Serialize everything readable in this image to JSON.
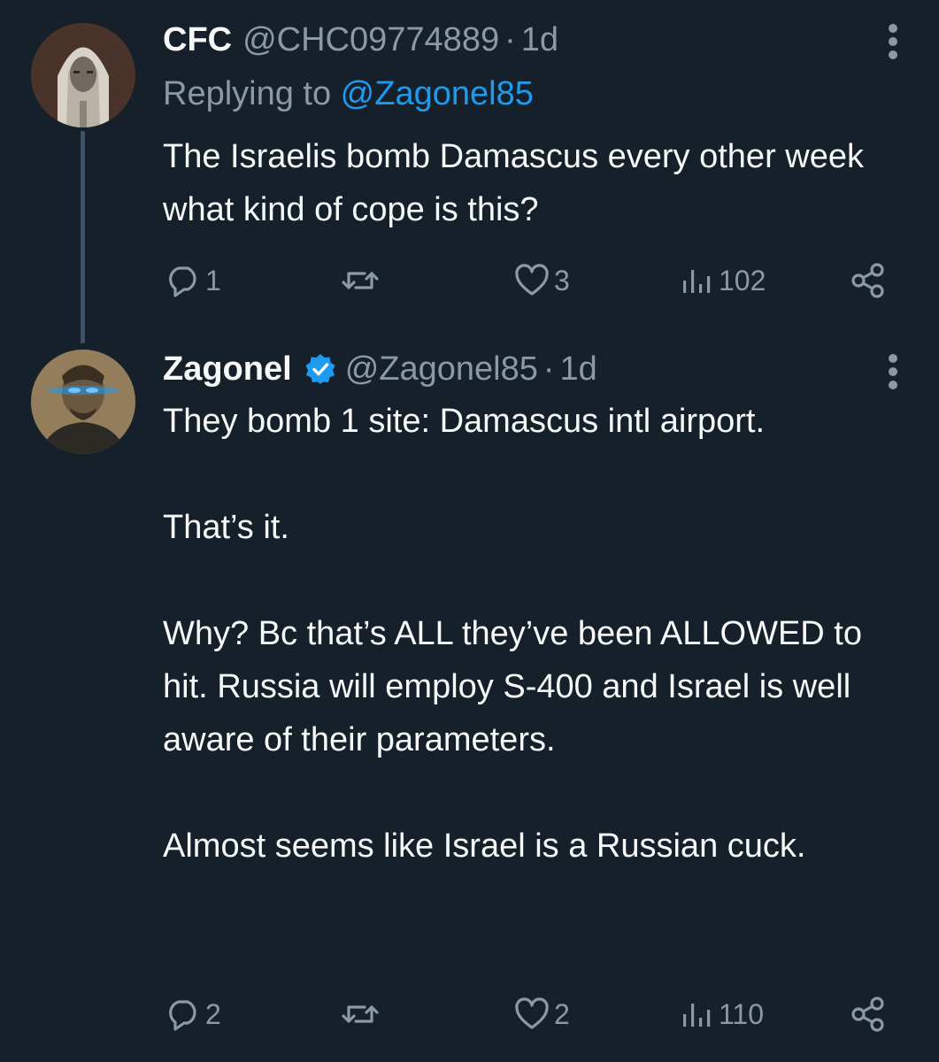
{
  "tweets": [
    {
      "name": "CFC",
      "handle": "@CHC09774889",
      "separator": "·",
      "time": "1d",
      "replying_prefix": "Replying to ",
      "replying_to": "@Zagonel85",
      "text": "The Israelis bomb Damascus every other week what kind of cope is this?",
      "stats": {
        "replies": "1",
        "reposts": "",
        "likes": "3",
        "views": "102"
      },
      "avatar_icon": "statue-portrait-avatar"
    },
    {
      "name": "Zagonel",
      "verified": true,
      "handle": "@Zagonel85",
      "separator": "·",
      "time": "1d",
      "text": "They bomb 1 site: Damascus intl airport.\n\nThat’s it.\n\nWhy? Bc that’s ALL they’ve been ALLOWED to hit. Russia will employ S-400 and Israel is well aware of their parameters.\n\nAlmost seems like Israel is a Russian cuck.",
      "stats": {
        "replies": "2",
        "reposts": "",
        "likes": "2",
        "views": "110"
      },
      "avatar_icon": "glowing-eyes-portrait-avatar"
    }
  ],
  "icons": {
    "reply": "reply-icon",
    "repost": "repost-icon",
    "like": "like-icon",
    "views": "views-icon",
    "share": "share-icon",
    "more": "more-vertical-icon",
    "verified": "verified-badge-icon"
  },
  "colors": {
    "background": "#15202b",
    "text": "#f7f9f9",
    "secondary": "#8b98a5",
    "link": "#1d9bf0",
    "thread_line": "#3d5466"
  }
}
